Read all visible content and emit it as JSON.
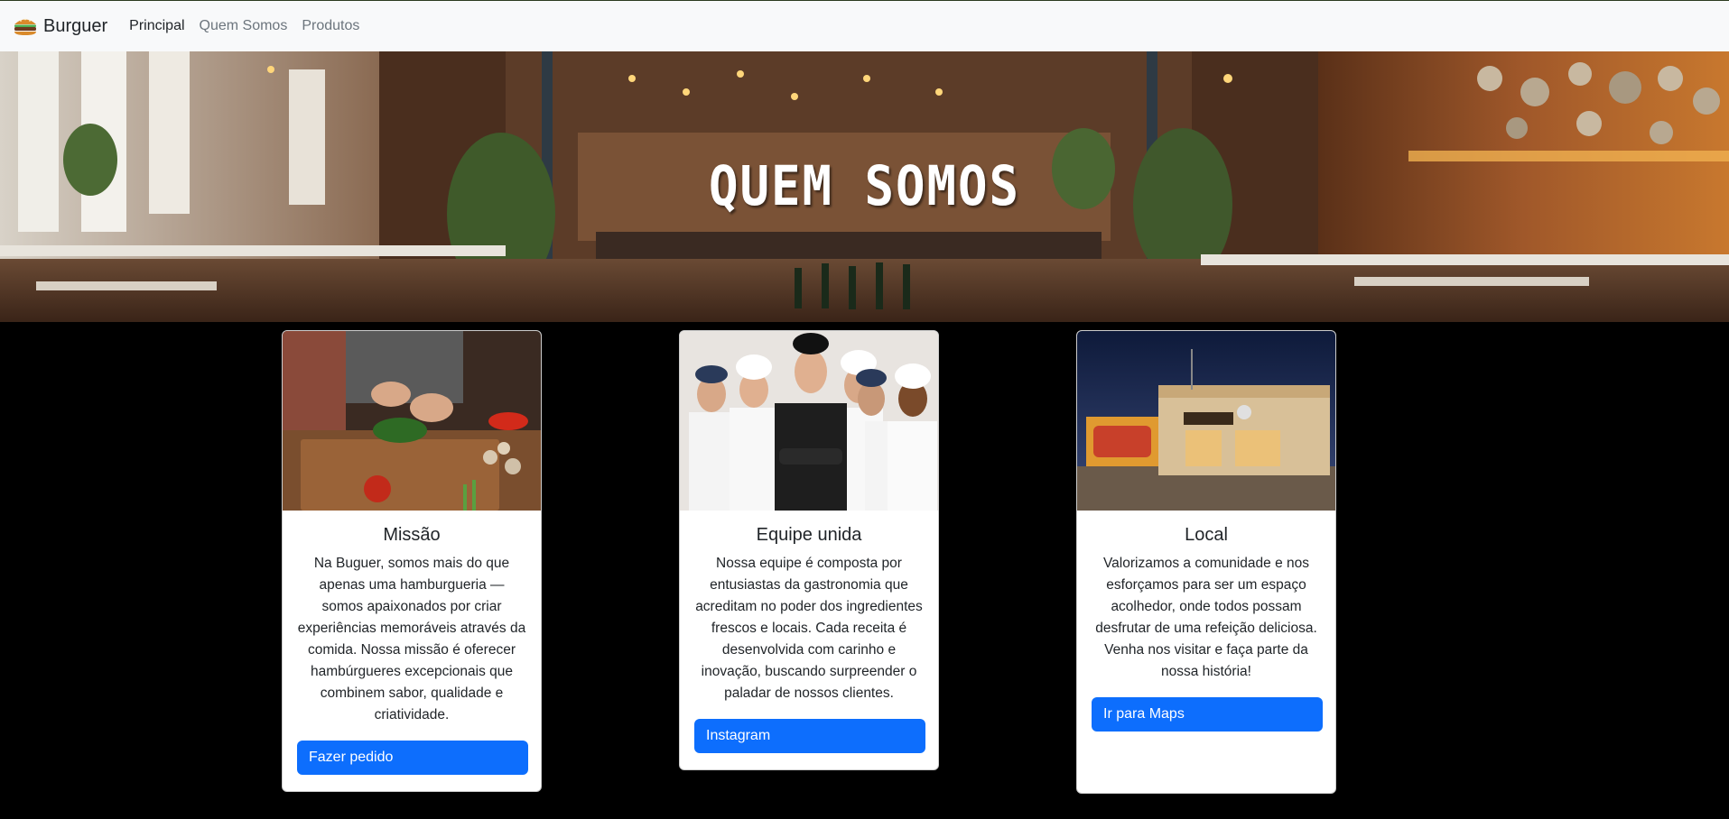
{
  "navbar": {
    "brand": "Burguer",
    "brand_icon": "burger-icon",
    "links": [
      {
        "label": "Principal",
        "active": true
      },
      {
        "label": "Quem Somos",
        "active": false
      },
      {
        "label": "Produtos",
        "active": false
      }
    ]
  },
  "hero": {
    "title": "QUEM SOMOS"
  },
  "cards": [
    {
      "title": "Missão",
      "text": "Na Buguer, somos mais do que apenas uma hamburgueria — somos apaixonados por criar experiências memoráveis através da comida. Nossa missão é oferecer hambúrgueres excepcionais que combinem sabor, qualidade e criatividade.",
      "button": "Fazer pedido"
    },
    {
      "title": "Equipe unida",
      "text": "Nossa equipe é composta por entusiastas da gastronomia que acreditam no poder dos ingredientes frescos e locais. Cada receita é desenvolvida com carinho e inovação, buscando surpreender o paladar de nossos clientes.",
      "button": "Instagram"
    },
    {
      "title": "Local",
      "text": "Valorizamos a comunidade e nos esforçamos para ser um espaço acolhedor, onde todos possam desfrutar de uma refeição deliciosa. Venha nos visitar e faça parte da nossa história!",
      "button": "Ir para Maps"
    }
  ],
  "colors": {
    "primary_button": "#0d6efd",
    "navbar_bg": "#f8f9fa",
    "page_bg": "#000000"
  }
}
